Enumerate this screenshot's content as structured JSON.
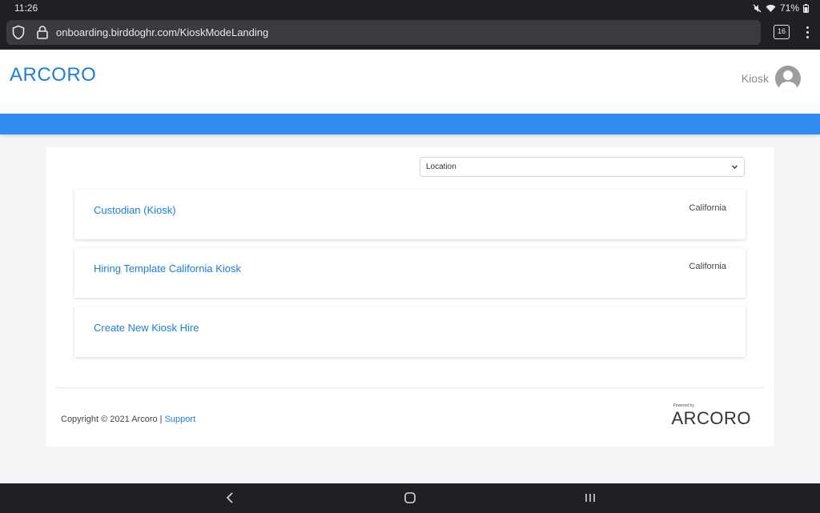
{
  "status_bar": {
    "time": "11:26",
    "battery": "71%",
    "icons": [
      "mute-icon",
      "wifi-icon",
      "battery-icon"
    ]
  },
  "browser": {
    "url": "onboarding.birddoghr.com/KioskModeLanding",
    "tab_count": "16",
    "icons": [
      "shield-icon",
      "lock-icon",
      "menu-dots-icon"
    ]
  },
  "header": {
    "logo": "ARCORO",
    "user_name": "Kiosk"
  },
  "colors": {
    "accent": "#2f8cf0",
    "link": "#1a7fd6"
  },
  "filter": {
    "location_label": "Location"
  },
  "templates": [
    {
      "title": "Custodian (Kiosk)",
      "location": "California"
    },
    {
      "title": "Hiring Template California Kiosk",
      "location": "California"
    },
    {
      "title": "Create New Kiosk Hire",
      "location": ""
    }
  ],
  "footer": {
    "copyright": "Copyright © 2021 Arcoro | ",
    "support_label": "Support",
    "powered_by": "Powered by",
    "powered_logo": "ARCORO"
  },
  "nav": {
    "icons": [
      "back-icon",
      "home-icon",
      "recents-icon"
    ]
  }
}
